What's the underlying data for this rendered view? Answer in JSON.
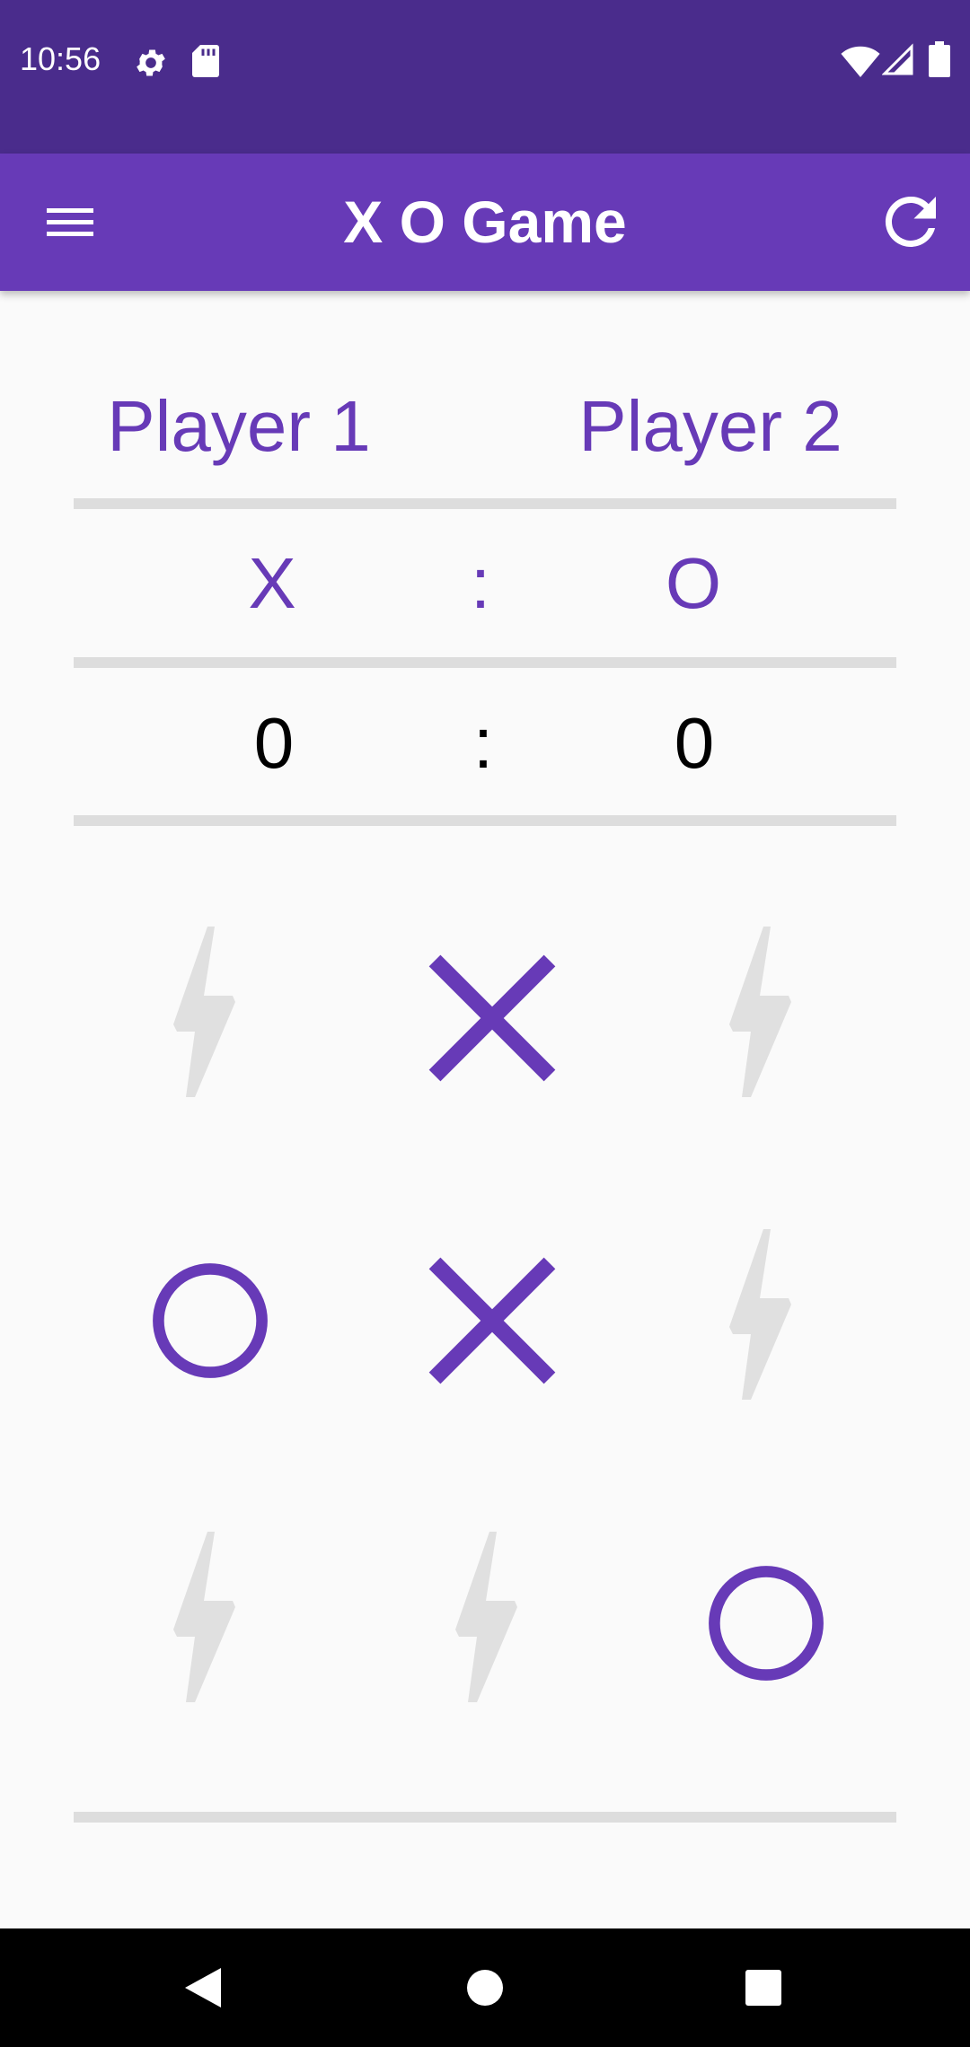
{
  "status_bar": {
    "time": "10:56",
    "icons": [
      "settings-icon",
      "sd-card-icon",
      "wifi-icon",
      "signal-icon",
      "battery-icon"
    ]
  },
  "app_bar": {
    "title": "X O Game",
    "left_icon": "menu-icon",
    "right_icon": "refresh-icon"
  },
  "scoreboard": {
    "player1_label": "Player 1",
    "player2_label": "Player 2",
    "player1_symbol": "X",
    "player2_symbol": "O",
    "symbol_separator": ":",
    "player1_score": "0",
    "player2_score": "0",
    "score_separator": ":"
  },
  "board": {
    "rows": [
      [
        "empty",
        "X",
        "empty"
      ],
      [
        "O",
        "X",
        "empty"
      ],
      [
        "empty",
        "empty",
        "O"
      ]
    ],
    "empty_icon": "lightning-icon"
  },
  "colors": {
    "status_bar": "#4A2C8C",
    "app_bar": "#673AB7",
    "accent": "#673AB7",
    "empty_cell_icon": "#E0E0E0",
    "divider": "#DDDDDD",
    "background": "#FAFAFA"
  },
  "nav_bar": {
    "buttons": [
      "back-icon",
      "home-icon",
      "recents-icon"
    ]
  }
}
